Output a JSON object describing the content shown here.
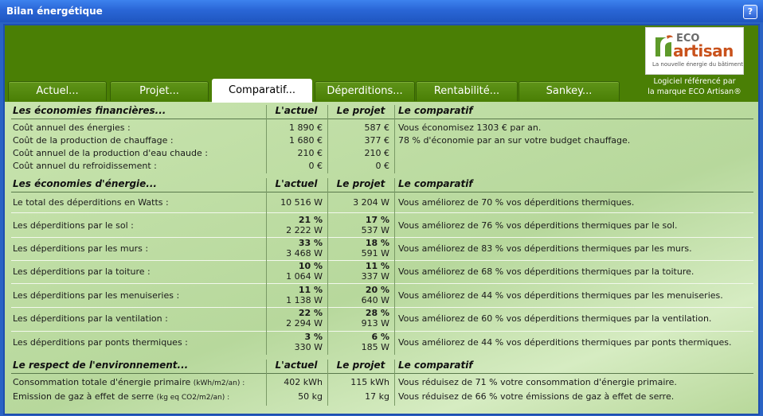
{
  "window": {
    "title": "Bilan énergétique",
    "help_label": "?"
  },
  "logo": {
    "eco": "ECO",
    "artisan": "artisan",
    "tagline": "La nouvelle énergie du bâtiment",
    "ref_line1": "Logiciel référencé par",
    "ref_line2": "la marque ECO Artisan®"
  },
  "tabs": [
    "Actuel...",
    "Projet...",
    "Comparatif...",
    "Déperditions...",
    "Rentabilité...",
    "Sankey..."
  ],
  "active_tab": "Comparatif...",
  "colors": {
    "title_bar": "#2a66d6",
    "band": "#4a7f05",
    "panel": "#b8d89a",
    "logo_accent": "#c9521c"
  },
  "sections": {
    "financial": {
      "header": {
        "label": "Les économies financières...",
        "actuel": "L'actuel",
        "projet": "Le projet",
        "comparatif": "Le comparatif"
      },
      "rows": [
        {
          "label": "Coût annuel des énergies :",
          "actuel": "1 890 €",
          "projet": "587 €",
          "comparatif": "Vous économisez 1303 € par an."
        },
        {
          "label": "Coût de la production de chauffage :",
          "actuel": "1 680 €",
          "projet": "377 €",
          "comparatif": "78 % d'économie par an sur votre budget chauffage."
        },
        {
          "label": "Coût annuel de la production d'eau chaude :",
          "actuel": "210 €",
          "projet": "210 €",
          "comparatif": ""
        },
        {
          "label": "Coût annuel du refroidissement :",
          "actuel": "0 €",
          "projet": "0 €",
          "comparatif": ""
        }
      ]
    },
    "energy": {
      "header": {
        "label": "Les économies d'énergie...",
        "actuel": "L'actuel",
        "projet": "Le projet",
        "comparatif": "Le comparatif"
      },
      "total": {
        "label": "Le total des déperditions en Watts :",
        "actuel": "10 516 W",
        "projet": "3 204 W",
        "comparatif": "Vous améliorez de 70 % vos déperditions thermiques."
      },
      "rows": [
        {
          "label": "Les déperditions par le sol :",
          "actuel_pct": "21 %",
          "actuel_w": "2 222 W",
          "projet_pct": "17 %",
          "projet_w": "537 W",
          "comparatif": "Vous améliorez de 76 % vos déperditions thermiques par le sol."
        },
        {
          "label": "Les déperditions par les murs :",
          "actuel_pct": "33 %",
          "actuel_w": "3 468 W",
          "projet_pct": "18 %",
          "projet_w": "591 W",
          "comparatif": "Vous améliorez de 83 % vos déperditions thermiques par les murs."
        },
        {
          "label": "Les déperditions par la toiture :",
          "actuel_pct": "10 %",
          "actuel_w": "1 064 W",
          "projet_pct": "11 %",
          "projet_w": "337 W",
          "comparatif": "Vous améliorez de 68 % vos déperditions thermiques par la toiture."
        },
        {
          "label": "Les déperditions par les menuiseries :",
          "actuel_pct": "11 %",
          "actuel_w": "1 138 W",
          "projet_pct": "20 %",
          "projet_w": "640 W",
          "comparatif": "Vous améliorez de 44 % vos déperditions thermiques par les menuiseries."
        },
        {
          "label": "Les déperditions par la ventilation :",
          "actuel_pct": "22 %",
          "actuel_w": "2 294 W",
          "projet_pct": "28 %",
          "projet_w": "913 W",
          "comparatif": "Vous améliorez de 60 % vos déperditions thermiques par la ventilation."
        },
        {
          "label": "Les déperditions par ponts thermiques :",
          "actuel_pct": "3 %",
          "actuel_w": "330 W",
          "projet_pct": "6 %",
          "projet_w": "185 W",
          "comparatif": "Vous améliorez de 44 % vos déperditions thermiques par ponts thermiques."
        }
      ]
    },
    "environment": {
      "header": {
        "label": "Le respect de l'environnement...",
        "actuel": "L'actuel",
        "projet": "Le projet",
        "comparatif": "Le comparatif"
      },
      "rows": [
        {
          "label": "Consommation totale d'énergie primaire",
          "unit": "(kWh/m2/an) :",
          "actuel": "402 kWh",
          "projet": "115 kWh",
          "comparatif": "Vous réduisez de 71 % votre consommation d'énergie primaire."
        },
        {
          "label": "Emission de gaz à effet de serre",
          "unit": "(kg eq CO2/m2/an) :",
          "actuel": "50 kg",
          "projet": "17 kg",
          "comparatif": "Vous réduisez de 66 % votre émissions de gaz à effet de serre."
        }
      ]
    }
  }
}
